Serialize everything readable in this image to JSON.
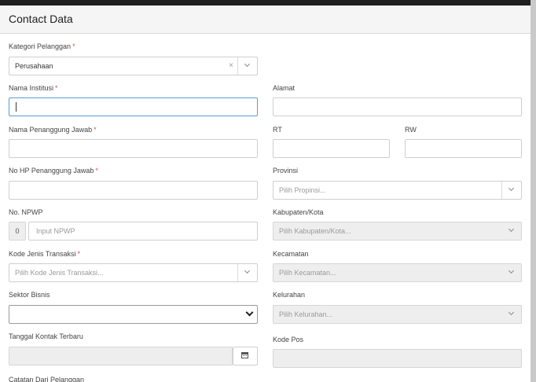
{
  "modal": {
    "title": "Contact Data"
  },
  "form": {
    "kategori": {
      "label": "Kategori Pelanggan",
      "required": "*",
      "value": "Perusahaan",
      "clear": "×"
    },
    "nama_institusi": {
      "label": "Nama Institusi",
      "required": "*",
      "value": ""
    },
    "alamat": {
      "label": "Alamat",
      "value": ""
    },
    "nama_penanggung": {
      "label": "Nama Penanggung Jawab",
      "required": "*",
      "value": ""
    },
    "rt": {
      "label": "RT",
      "value": ""
    },
    "rw": {
      "label": "RW",
      "value": ""
    },
    "no_hp": {
      "label": "No HP Penanggung Jawab",
      "required": "*",
      "value": ""
    },
    "provinsi": {
      "label": "Provinsi",
      "placeholder": "Pilih Propinsi..."
    },
    "npwp": {
      "label": "No. NPWP",
      "prefix": "0",
      "placeholder": "Input NPWP"
    },
    "kabupaten": {
      "label": "Kabupaten/Kota",
      "placeholder": "Pilih Kabupaten/Kota..."
    },
    "kode_jenis": {
      "label": "Kode Jenis Transaksi",
      "required": "*",
      "placeholder": "Pilih Kode Jenis Transaksi..."
    },
    "kecamatan": {
      "label": "Kecamatan",
      "placeholder": "Pilih Kecamatan..."
    },
    "sektor": {
      "label": "Sektor Bisnis",
      "value": ""
    },
    "kelurahan": {
      "label": "Kelurahan",
      "placeholder": "Pilih Kelurahan..."
    },
    "tanggal": {
      "label": "Tanggal Kontak Terbaru",
      "value": ""
    },
    "kode_pos": {
      "label": "Kode Pos",
      "value": ""
    },
    "catatan": {
      "label": "Catatan Dari Pelanggan"
    }
  },
  "icons": {
    "calendar": "calendar-icon",
    "chevron": "chevron-down-icon",
    "clear": "clear-icon"
  }
}
